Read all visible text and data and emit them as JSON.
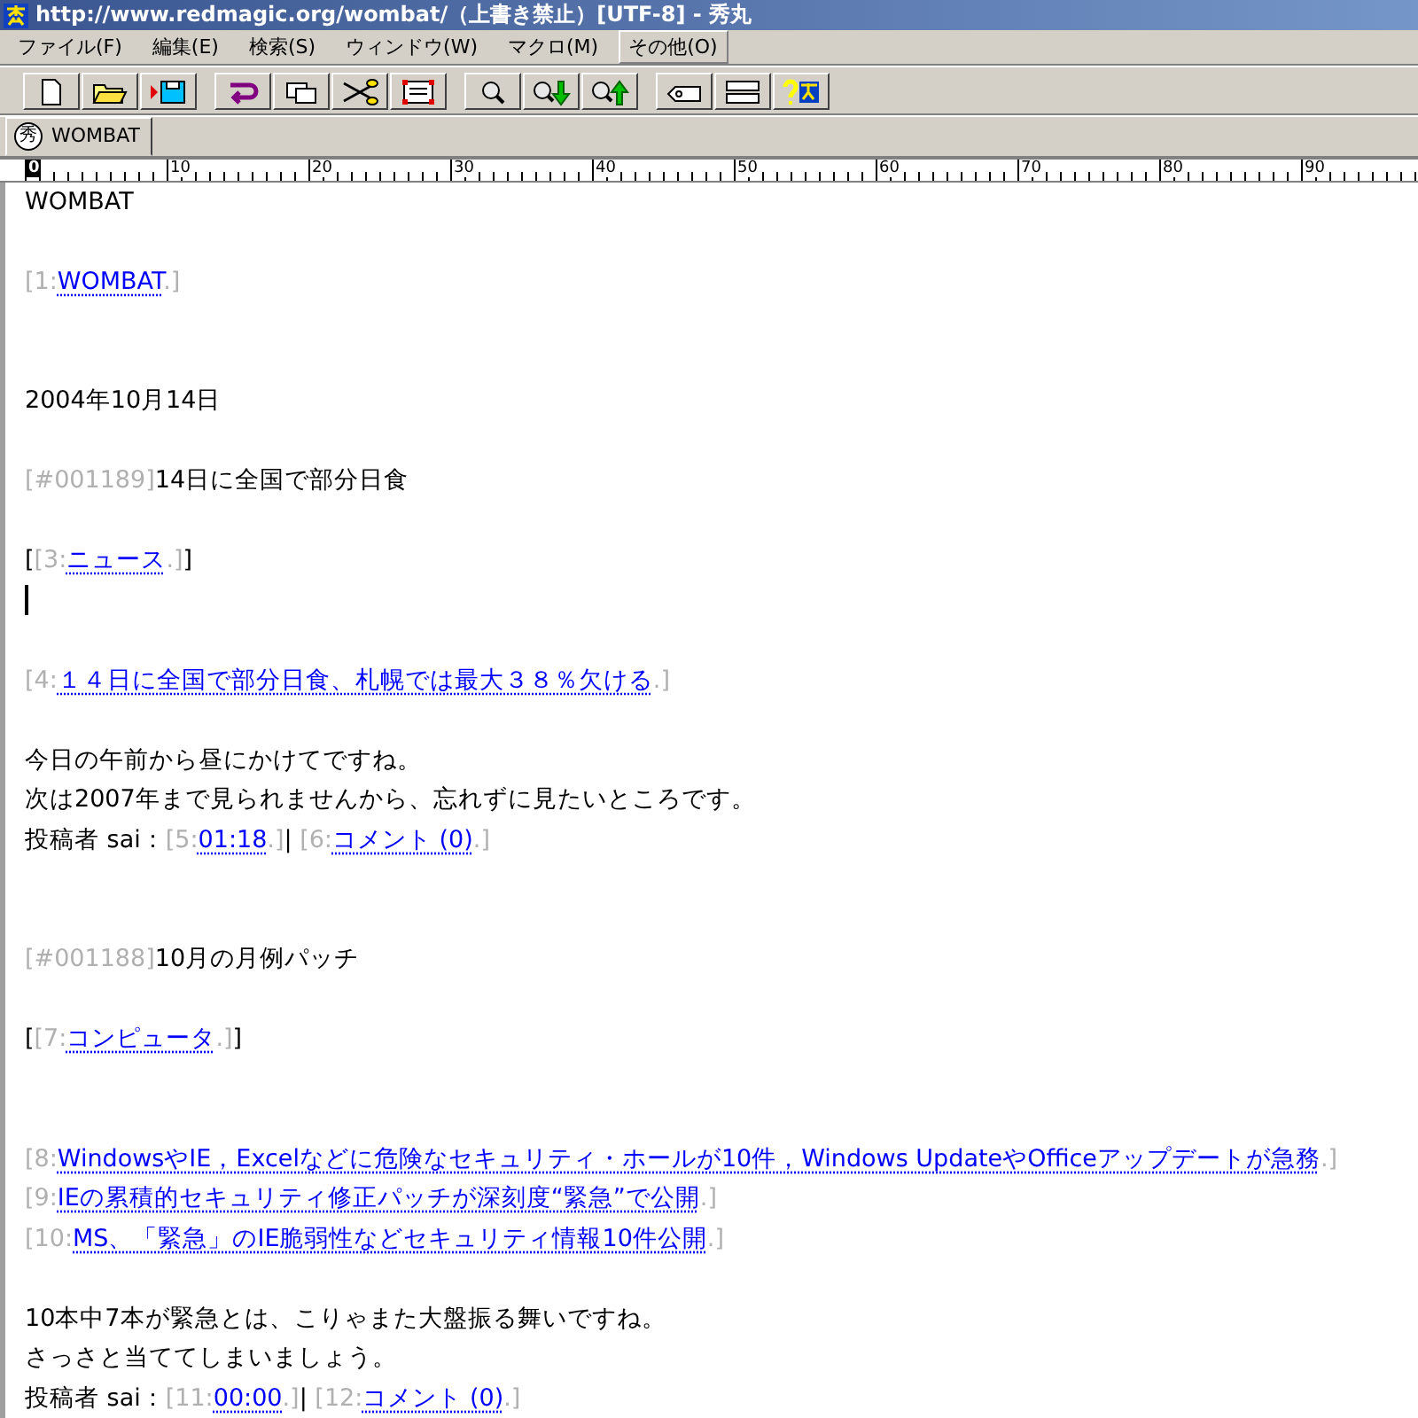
{
  "window": {
    "title": "http://www.redmagic.org/wombat/（上書き禁止）[UTF-8] - 秀丸"
  },
  "menu": [
    {
      "label": "ファイル(F)",
      "selected": false
    },
    {
      "label": "編集(E)",
      "selected": false
    },
    {
      "label": "検索(S)",
      "selected": false
    },
    {
      "label": "ウィンドウ(W)",
      "selected": false
    },
    {
      "label": "マクロ(M)",
      "selected": false
    },
    {
      "label": "その他(O)",
      "selected": true
    }
  ],
  "tabs": [
    {
      "label": "WOMBAT",
      "glyph": "秀",
      "selected": true
    }
  ],
  "ruler": [
    {
      "label": "0",
      "selected": true
    },
    {
      "label": "10",
      "selected": false
    },
    {
      "label": "20",
      "selected": false
    },
    {
      "label": "30",
      "selected": false
    },
    {
      "label": "40",
      "selected": false
    },
    {
      "label": "50",
      "selected": false
    },
    {
      "label": "60",
      "selected": false
    },
    {
      "label": "70",
      "selected": false
    },
    {
      "label": "80",
      "selected": false
    },
    {
      "label": "90",
      "selected": false
    }
  ],
  "lines": [
    {
      "kind": "text",
      "parts": [
        {
          "kind": "plain",
          "text": "WOMBAT"
        }
      ]
    },
    {
      "kind": "blank"
    },
    {
      "kind": "text",
      "parts": [
        {
          "kind": "link",
          "prefix": "[1:",
          "text": "WOMBAT",
          "suffix": ".]"
        }
      ]
    },
    {
      "kind": "blank"
    },
    {
      "kind": "blank"
    },
    {
      "kind": "text",
      "parts": [
        {
          "kind": "plain",
          "text": "2004年10月14日"
        }
      ]
    },
    {
      "kind": "blank"
    },
    {
      "kind": "text",
      "parts": [
        {
          "kind": "mark",
          "text": "[#001189]"
        },
        {
          "kind": "plain",
          "text": "14日に全国で部分日食"
        }
      ]
    },
    {
      "kind": "blank"
    },
    {
      "kind": "text",
      "parts": [
        {
          "kind": "plain",
          "text": "["
        },
        {
          "kind": "link",
          "prefix": "[3:",
          "text": "ニュース",
          "suffix": ".]"
        },
        {
          "kind": "plain",
          "text": "]"
        }
      ]
    },
    {
      "kind": "cursor"
    },
    {
      "kind": "blank"
    },
    {
      "kind": "text",
      "parts": [
        {
          "kind": "link",
          "prefix": "[4:",
          "text": "１４日に全国で部分日食、札幌では最大３８％欠ける",
          "suffix": ".]"
        }
      ]
    },
    {
      "kind": "blank"
    },
    {
      "kind": "text",
      "parts": [
        {
          "kind": "plain",
          "text": "今日の午前から昼にかけてですね。"
        }
      ]
    },
    {
      "kind": "text",
      "parts": [
        {
          "kind": "plain",
          "text": "次は2007年まで見られませんから、忘れずに見たいところです。"
        }
      ]
    },
    {
      "kind": "text",
      "parts": [
        {
          "kind": "plain",
          "text": "投稿者 sai："
        },
        {
          "kind": "link",
          "prefix": "[5:",
          "text": "01:18",
          "suffix": ".]"
        },
        {
          "kind": "plain",
          "text": "| "
        },
        {
          "kind": "link",
          "prefix": "[6:",
          "text": "コメント (0)",
          "suffix": ".]"
        }
      ]
    },
    {
      "kind": "blank"
    },
    {
      "kind": "blank"
    },
    {
      "kind": "text",
      "parts": [
        {
          "kind": "mark",
          "text": "[#001188]"
        },
        {
          "kind": "plain",
          "text": "10月の月例パッチ"
        }
      ]
    },
    {
      "kind": "blank"
    },
    {
      "kind": "text",
      "parts": [
        {
          "kind": "plain",
          "text": "["
        },
        {
          "kind": "link",
          "prefix": "[7:",
          "text": "コンピュータ",
          "suffix": ".]"
        },
        {
          "kind": "plain",
          "text": "]"
        }
      ]
    },
    {
      "kind": "blank"
    },
    {
      "kind": "blank"
    },
    {
      "kind": "text",
      "parts": [
        {
          "kind": "link",
          "prefix": "[8:",
          "text": "WindowsやIE，Excelなどに危険なセキュリティ・ホールが10件，Windows UpdateやOfficeアップデートが急務",
          "suffix": ".]"
        }
      ]
    },
    {
      "kind": "text",
      "parts": [
        {
          "kind": "link",
          "prefix": "[9:",
          "text": "IEの累積的セキュリティ修正パッチが深刻度“緊急”で公開",
          "suffix": ".]"
        }
      ]
    },
    {
      "kind": "text",
      "parts": [
        {
          "kind": "link",
          "prefix": "[10:",
          "text": "MS、「緊急」のIE脆弱性などセキュリティ情報10件公開",
          "suffix": ".]"
        }
      ]
    },
    {
      "kind": "blank"
    },
    {
      "kind": "text",
      "parts": [
        {
          "kind": "plain",
          "text": "10本中7本が緊急とは、こりゃまた大盤振る舞いですね。"
        }
      ]
    },
    {
      "kind": "text",
      "parts": [
        {
          "kind": "plain",
          "text": "さっさと当ててしまいましょう。"
        }
      ]
    },
    {
      "kind": "text",
      "parts": [
        {
          "kind": "plain",
          "text": "投稿者 sai："
        },
        {
          "kind": "link",
          "prefix": "[11:",
          "text": "00:00",
          "suffix": ".]"
        },
        {
          "kind": "plain",
          "text": "| "
        },
        {
          "kind": "link",
          "prefix": "[12:",
          "text": "コメント (0)",
          "suffix": ".]"
        }
      ]
    }
  ]
}
